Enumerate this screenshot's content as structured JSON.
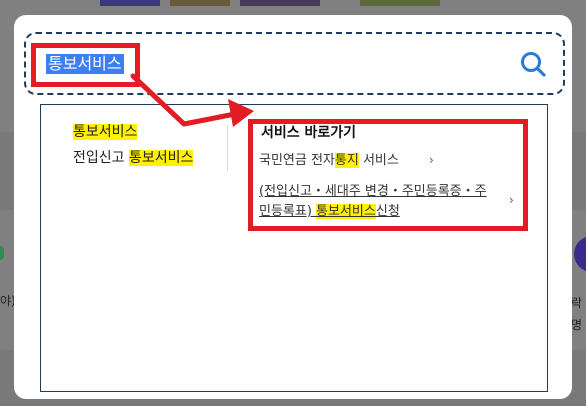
{
  "search": {
    "query": "통보서비스"
  },
  "suggestions": [
    {
      "prefix": "",
      "match": "통보서비스"
    },
    {
      "prefix": "전입신고 ",
      "match": "통보서비스"
    }
  ],
  "services": {
    "title": "서비스 바로가기",
    "items": [
      {
        "pre": "국민연금 전자",
        "match": "통지",
        "post": " 서비스"
      },
      {
        "pre": "(전입신고・세대주 변경・주민등록증・주민등록표) ",
        "match": "통보서비스",
        "post": "신청"
      }
    ]
  },
  "background": {
    "left_text": "야)",
    "right_text_1": "가락",
    "right_text_2": "증명"
  },
  "icons": {
    "search": "search-icon",
    "chevron": "chevron-right-icon"
  },
  "colors": {
    "selection": "#3d7ff2",
    "highlight": "#fff100",
    "annotation": "#e21b25",
    "accent": "#2a7bd4"
  }
}
